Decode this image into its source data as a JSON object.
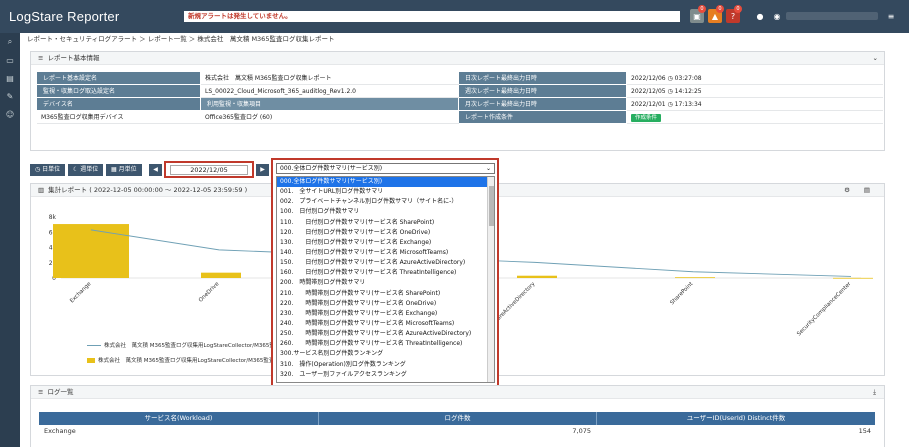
{
  "app": {
    "title": "LogStare Reporter"
  },
  "topbar": {
    "alert_text": "新規アラートは発生していません。",
    "badges": [
      "0",
      "0",
      "0"
    ],
    "icons": [
      "monitor-icon",
      "warning-icon",
      "question-icon",
      "info-icon",
      "user-icon",
      "menu-icon"
    ]
  },
  "sidebar": {
    "icons": [
      "search-icon",
      "report-icon",
      "document-icon",
      "wrench-icon",
      "users-icon"
    ]
  },
  "breadcrumb": "レポート・セキュリティログアラート ＞ レポート一覧 ＞ 株式会社　萬文積 M365監査ログ収集レポート",
  "basic_info": {
    "title": "レポート基本情報",
    "rows": [
      {
        "h1": "レポート基本設定名",
        "v1": "株式会社　萬文積 M365監査ログ収集レポート",
        "h2": "日次レポート最終出力日時",
        "v2": "2022/12/06 ◷ 03:27:08"
      },
      {
        "h1": "監視・収集ログ取込設定名",
        "v1": "LS_00022_Cloud_Microsoft_365_auditlog_Rev1.2.0",
        "h2": "週次レポート最終出力日時",
        "v2": "2022/12/05 ◷ 14:12:25"
      },
      {
        "h1": "デバイス名",
        "v1": "利用監視・収集項目",
        "h2": "月次レポート最終出力日時",
        "v2": "2022/12/01 ◷ 17:13:34"
      },
      {
        "h1": "M365監査ログ収集用デバイス",
        "v1": "Office365監査ログ (60)",
        "h2": "レポート作成条件",
        "v2": "作成条件"
      }
    ]
  },
  "toolbar": {
    "day_label": "日単位",
    "week_label": "週単位",
    "month_label": "月単位",
    "date_value": "2022/12/05",
    "selected_report": "000.全体ログ件数サマリ(サービス別)"
  },
  "report": {
    "title": "集計レポート ( 2022-12-05 00:00:00 〜 2022-12-05 23:59:59 )",
    "legend_line": "株式会社　萬文積 M365監査ログ収集用LogStareCollector/M365監査ログ",
    "legend_bar": "株式会社　萬文積 M365監査ログ収集用LogStareCollector/M365監査ログ"
  },
  "chart_data": {
    "type": "bar",
    "categories": [
      "Exchange",
      "OneDrive",
      "SharePoint",
      "AzureActiveDirectory",
      "SharePoint",
      "SecurityComplianceCenter"
    ],
    "values": [
      7075,
      700,
      500,
      300,
      100,
      20
    ],
    "line_values": [
      154,
      90,
      70,
      50,
      20,
      5
    ],
    "yticks": [
      "0",
      "2k",
      "4k",
      "6k",
      "8k"
    ],
    "ylim": [
      0,
      8000
    ],
    "colors": {
      "bar": "#e8c11a",
      "line": "#6fa0b5"
    }
  },
  "dropdown": {
    "options": [
      "000.全体ログ件数サマリ(サービス別)",
      "001.　全サイトURL別ログ件数サマリ",
      "002.　プライベートチャンネル別ログ件数サマリ（サイト名に-）",
      "100.　日付別ログ件数サマリ",
      "110.　　日付別ログ件数サマリ(サービス名 SharePoint)",
      "120.　　日付別ログ件数サマリ(サービス名 OneDrive)",
      "130.　　日付別ログ件数サマリ(サービス名 Exchange)",
      "140.　　日付別ログ件数サマリ(サービス名 MicrosoftTeams)",
      "150.　　日付別ログ件数サマリ(サービス名 AzureActiveDirectory)",
      "160.　　日付別ログ件数サマリ(サービス名 ThreatIntelligence)",
      "200.　時間帯別ログ件数サマリ",
      "210.　　時間帯別ログ件数サマリ(サービス名 SharePoint)",
      "220.　　時間帯別ログ件数サマリ(サービス名 OneDrive)",
      "230.　　時間帯別ログ件数サマリ(サービス名 Exchange)",
      "240.　　時間帯別ログ件数サマリ(サービス名 MicrosoftTeams)",
      "250.　　時間帯別ログ件数サマリ(サービス名 AzureActiveDirectory)",
      "260.　　時間帯別ログ件数サマリ(サービス名 ThreatIntelligence)",
      "300.サービス名別ログ件数ランキング",
      "310.　操作(Operation)別ログ件数ランキング",
      "320.　ユーザー別ファイルアクセスランキング"
    ]
  },
  "log_list": {
    "title": "ログ一覧",
    "columns": [
      "サービス名(Workload)",
      "ログ件数",
      "ユーザーID(UserId) Distinct件数"
    ],
    "rows": [
      [
        "Exchange",
        "7,075",
        "154"
      ]
    ]
  }
}
